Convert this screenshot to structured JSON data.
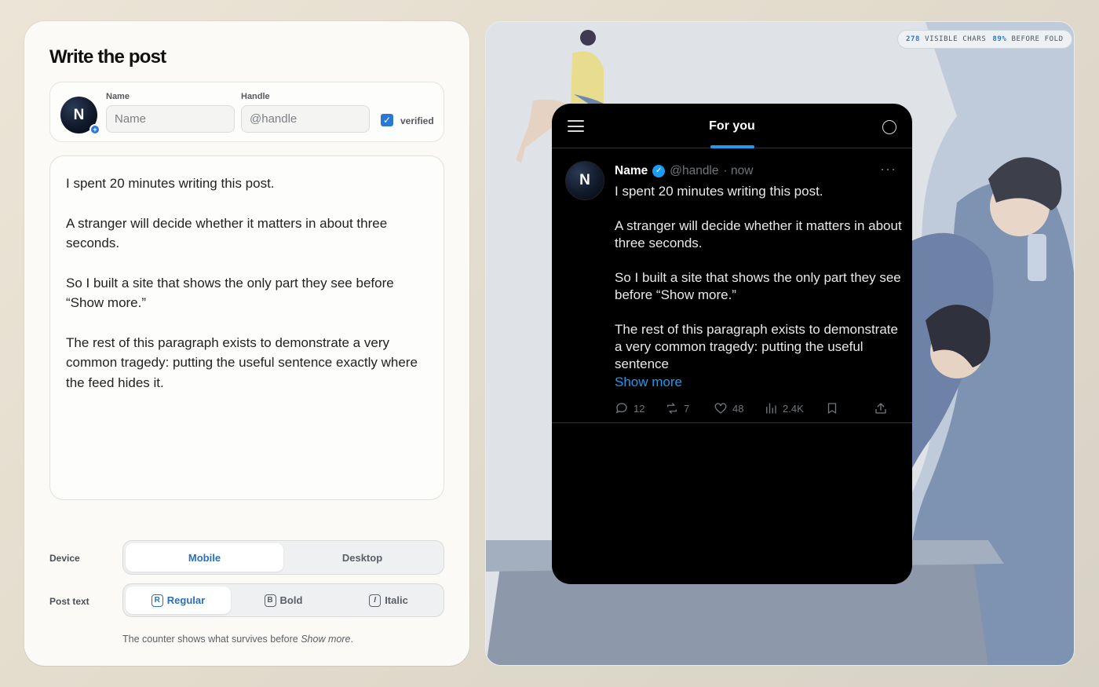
{
  "editor": {
    "title": "Write the post",
    "name_label": "Name",
    "name_placeholder": "Name",
    "handle_label": "Handle",
    "handle_placeholder": "@handle",
    "avatar_initial": "N",
    "verified_label": "verified",
    "verified_checked": true,
    "post_paragraphs": [
      "I spent 20 minutes writing this post.",
      "A stranger will decide whether it matters in about three seconds.",
      "So I built a site that shows the only part they see before “Show more.”",
      "The rest of this paragraph exists to demonstrate a very common tragedy: putting the useful sentence exactly where the feed hides it."
    ],
    "device_label": "Device",
    "device_options": [
      "Mobile",
      "Desktop"
    ],
    "device_selected": "Mobile",
    "post_text_label": "Post text",
    "style_options": [
      {
        "key": "R",
        "label": "Regular"
      },
      {
        "key": "B",
        "label": "Bold"
      },
      {
        "key": "I",
        "label": "Italic"
      }
    ],
    "style_selected": "Regular",
    "footnote_prefix": "The counter shows what survives before ",
    "footnote_em": "Show more",
    "footnote_suffix": "."
  },
  "preview": {
    "counter_chars_value": "278",
    "counter_chars_label": "VISIBLE CHARS",
    "counter_fold_value": "89%",
    "counter_fold_label": "BEFORE FOLD",
    "tab_label": "For you",
    "tweet": {
      "avatar_initial": "N",
      "name": "Name",
      "handle": "@handle",
      "time": "· now",
      "paragraphs": [
        "I spent 20 minutes writing this post.",
        "A stranger will decide whether it matters in about three seconds.",
        "So I built a site that shows the only part they see before “Show more.”",
        "The rest of this paragraph exists to demonstrate a very common tragedy: putting the useful sentence"
      ],
      "show_more": "Show more",
      "replies": "12",
      "reposts": "7",
      "likes": "48",
      "views": "2.4K"
    }
  },
  "colors": {
    "accent": "#2a77d4",
    "twitter_blue": "#1d9bf0",
    "phone_bg": "#000000",
    "panel_bg": "#fbfaf6"
  },
  "icons": [
    "menu-icon",
    "circle-icon",
    "verified-icon",
    "more-icon",
    "reply-icon",
    "repost-icon",
    "like-icon",
    "views-icon",
    "bookmark-icon",
    "share-icon"
  ]
}
